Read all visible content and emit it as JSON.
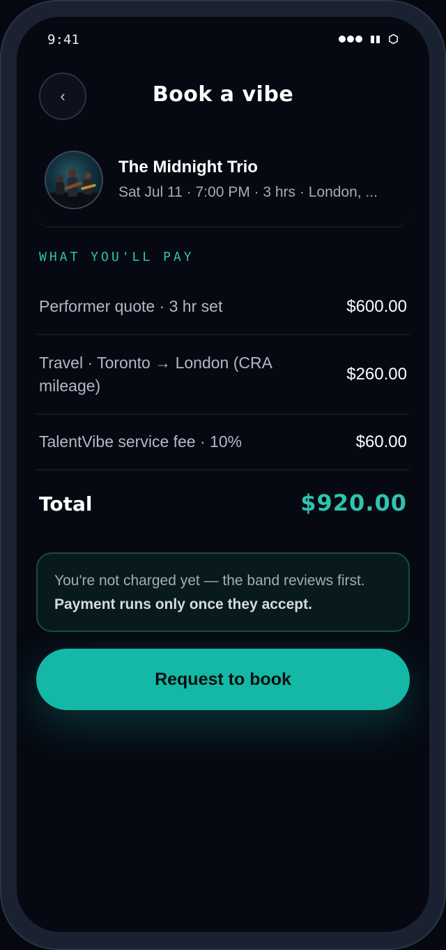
{
  "status_bar": {
    "time": "9:41"
  },
  "header": {
    "back_label": "‹",
    "title": "Book a vibe"
  },
  "performer": {
    "name": "The Midnight Trio",
    "meta": "Sat Jul 11 · 7:00 PM · 3 hrs · London, ..."
  },
  "section_label": "WHAT YOU'LL PAY",
  "line_items": [
    {
      "label": "Performer quote · 3 hr set",
      "amount": "$600.00"
    },
    {
      "label": "Travel · Toronto → London (CRA mileage)",
      "amount": "$260.00"
    },
    {
      "label": "TalentVibe service fee · 10%",
      "amount": "$60.00"
    }
  ],
  "total": {
    "label": "Total",
    "amount": "$920.00"
  },
  "notice": {
    "text": "You're not charged yet — the band reviews first. ",
    "emphasis": "Payment runs only once they accept."
  },
  "cta": {
    "label": "Request to book"
  },
  "colors": {
    "accent": "#15b8a6",
    "background": "#060912"
  }
}
